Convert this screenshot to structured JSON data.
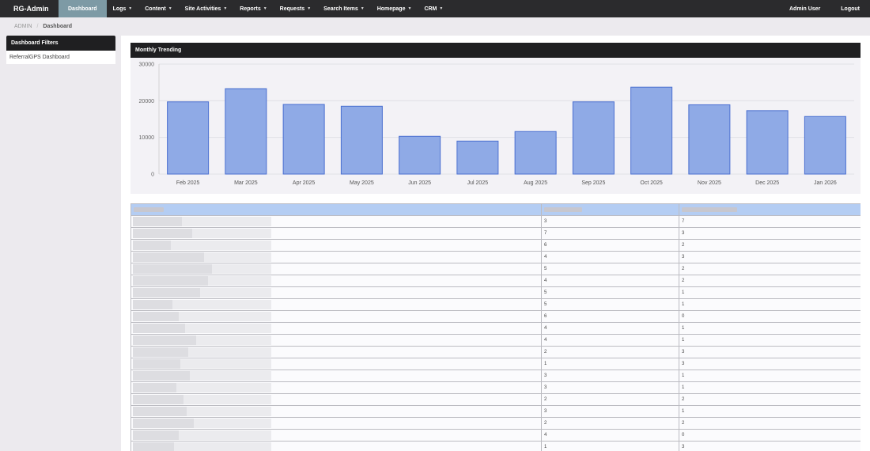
{
  "nav": {
    "brand": "RG-Admin",
    "items": [
      {
        "label": "Dashboard",
        "active": true,
        "dropdown": false
      },
      {
        "label": "Logs",
        "dropdown": true
      },
      {
        "label": "Content",
        "dropdown": true
      },
      {
        "label": "Site Activities",
        "dropdown": true
      },
      {
        "label": "Reports",
        "dropdown": true
      },
      {
        "label": "Requests",
        "dropdown": true
      },
      {
        "label": "Search Items",
        "dropdown": true
      },
      {
        "label": "Homepage",
        "dropdown": true
      },
      {
        "label": "CRM",
        "dropdown": true
      }
    ],
    "user": "Admin User",
    "logout": "Logout",
    "caret_icon": "caret-down-icon"
  },
  "breadcrumb": {
    "root": "ADMIN",
    "separator": "/",
    "current": "Dashboard"
  },
  "sidebar": {
    "header": "Dashboard Filters",
    "link": "ReferralGPS Dashboard"
  },
  "panel": {
    "title": "Monthly Trending"
  },
  "chart_data": {
    "type": "bar",
    "categories": [
      "Feb 2025",
      "Mar 2025",
      "Apr 2025",
      "May 2025",
      "Jun 2025",
      "Jul 2025",
      "Aug 2025",
      "Sep 2025",
      "Oct 2025",
      "Nov 2025",
      "Dec 2025",
      "Jan 2026"
    ],
    "values": [
      19700,
      23300,
      19000,
      18500,
      10300,
      9000,
      11600,
      19700,
      23700,
      18900,
      17300,
      15700
    ],
    "ylim": [
      0,
      30000
    ],
    "yticks": [
      0,
      10000,
      20000,
      30000
    ],
    "grid": true,
    "bar_color": "#8faae6",
    "bar_border": "#4a6fd0"
  },
  "table": {
    "header_color": "#b4cdf3",
    "rows": [
      {
        "b": "3",
        "c": "7"
      },
      {
        "b": "7",
        "c": "3"
      },
      {
        "b": "6",
        "c": "2"
      },
      {
        "b": "4",
        "c": "3"
      },
      {
        "b": "5",
        "c": "2"
      },
      {
        "b": "4",
        "c": "2"
      },
      {
        "b": "5",
        "c": "1"
      },
      {
        "b": "5",
        "c": "1"
      },
      {
        "b": "6",
        "c": "0"
      },
      {
        "b": "4",
        "c": "1"
      },
      {
        "b": "4",
        "c": "1"
      },
      {
        "b": "2",
        "c": "3"
      },
      {
        "b": "1",
        "c": "3"
      },
      {
        "b": "3",
        "c": "1"
      },
      {
        "b": "3",
        "c": "1"
      },
      {
        "b": "2",
        "c": "2"
      },
      {
        "b": "3",
        "c": "1"
      },
      {
        "b": "2",
        "c": "2"
      },
      {
        "b": "4",
        "c": "0"
      },
      {
        "b": "1",
        "c": "3"
      }
    ]
  }
}
